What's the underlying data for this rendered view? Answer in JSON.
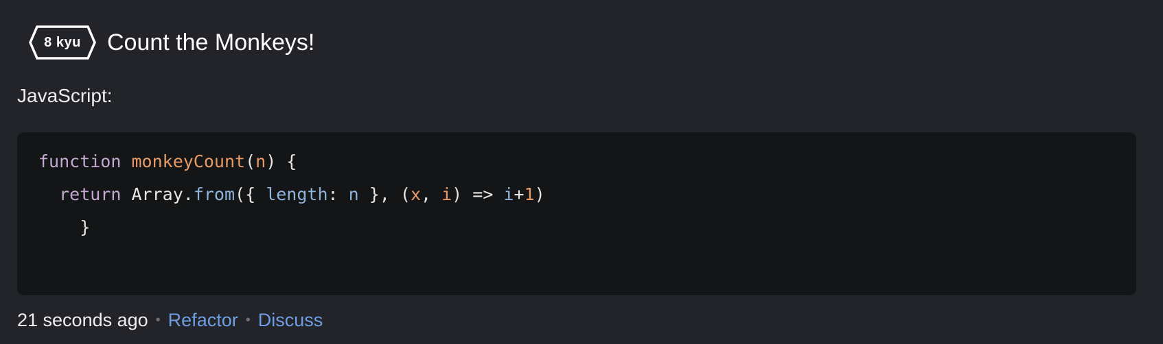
{
  "kata": {
    "rank": "8 kyu",
    "title": "Count the Monkeys!",
    "language_label": "JavaScript:"
  },
  "code": {
    "line1": {
      "keyword": "function",
      "name": "monkeyCount",
      "open_paren": "(",
      "param": "n",
      "rest": ") {"
    },
    "line2": {
      "keyword": "return",
      "object": "Array",
      "dot": ".",
      "method": "from",
      "open": "({ ",
      "prop": "length",
      "colon": ": ",
      "val": "n",
      "close_obj": " }, (",
      "arg1": "x",
      "comma": ", ",
      "arg2": "i",
      "arrow": ") => ",
      "ret_var": "i",
      "plus": "+",
      "ret_num": "1",
      "close": ")"
    },
    "line3": {
      "brace": "}"
    }
  },
  "footer": {
    "timestamp": "21 seconds ago",
    "separator": "•",
    "refactor_label": "Refactor",
    "discuss_label": "Discuss"
  },
  "colors": {
    "background": "#232429",
    "code_background": "#131516",
    "link": "#6f9ee3",
    "keyword": "#c3a8d1",
    "function_name": "#e89b67",
    "property": "#8fb3d9"
  },
  "icons": {
    "rank_badge": "hexagon-badge-icon"
  }
}
